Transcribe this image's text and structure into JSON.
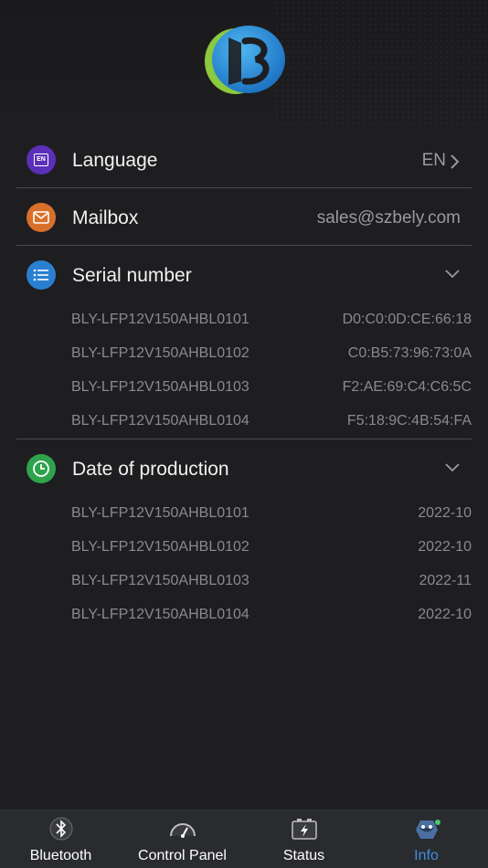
{
  "settings": {
    "language": {
      "label": "Language",
      "value": "EN",
      "icon": "language-icon",
      "icon_text": "EN",
      "color": "#5b2fb8"
    },
    "mailbox": {
      "label": "Mailbox",
      "value": "sales@szbely.com",
      "icon": "mail-icon",
      "color": "#d8702b"
    },
    "serial": {
      "label": "Serial number",
      "icon": "list-icon",
      "color": "#2a7fd0",
      "items": [
        {
          "name": "BLY-LFP12V150AHBL0101",
          "value": "D0:C0:0D:CE:66:18"
        },
        {
          "name": "BLY-LFP12V150AHBL0102",
          "value": "C0:B5:73:96:73:0A"
        },
        {
          "name": "BLY-LFP12V150AHBL0103",
          "value": "F2:AE:69:C4:C6:5C"
        },
        {
          "name": "BLY-LFP12V150AHBL0104",
          "value": "F5:18:9C:4B:54:FA"
        }
      ]
    },
    "production": {
      "label": "Date of production",
      "icon": "clock-icon",
      "color": "#2ea34b",
      "items": [
        {
          "name": "BLY-LFP12V150AHBL0101",
          "value": "2022-10"
        },
        {
          "name": "BLY-LFP12V150AHBL0102",
          "value": "2022-10"
        },
        {
          "name": "BLY-LFP12V150AHBL0103",
          "value": "2022-11"
        },
        {
          "name": "BLY-LFP12V150AHBL0104",
          "value": "2022-10"
        }
      ]
    }
  },
  "tabbar": {
    "bluetooth": "Bluetooth",
    "control_panel": "Control Panel",
    "status": "Status",
    "info": "Info",
    "active": "info",
    "active_color": "#3e8ee0"
  }
}
